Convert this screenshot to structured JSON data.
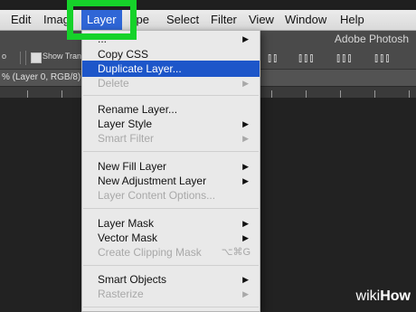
{
  "menubar": {
    "items": [
      {
        "label": "Edit"
      },
      {
        "label": "Imag"
      },
      {
        "label": "Layer"
      },
      {
        "label": "ype"
      },
      {
        "label": "Select"
      },
      {
        "label": "Filter"
      },
      {
        "label": "View"
      },
      {
        "label": "Window"
      },
      {
        "label": "Help"
      }
    ]
  },
  "options_bar": {
    "doc_app": "Adobe Photosh",
    "show_transform": "Show Transf",
    "left_fragment": "o"
  },
  "tab": {
    "label": "% (Layer 0, RGB/8) *"
  },
  "layer_menu": {
    "items": [
      {
        "label": "...",
        "submenu": true
      },
      {
        "label": "Copy CSS"
      },
      {
        "label": "Duplicate Layer...",
        "highlight": true
      },
      {
        "label": "Delete",
        "disabled": true,
        "submenu": true
      },
      {
        "label": "Rename Layer..."
      },
      {
        "label": "Layer Style",
        "submenu": true
      },
      {
        "label": "Smart Filter",
        "disabled": true,
        "submenu": true
      },
      {
        "label": "New Fill Layer",
        "submenu": true
      },
      {
        "label": "New Adjustment Layer",
        "submenu": true
      },
      {
        "label": "Layer Content Options...",
        "disabled": true
      },
      {
        "label": "Layer Mask",
        "submenu": true
      },
      {
        "label": "Vector Mask",
        "submenu": true
      },
      {
        "label": "Create Clipping Mask",
        "disabled": true,
        "shortcut": "⌥⌘G"
      },
      {
        "label": "Smart Objects",
        "submenu": true
      },
      {
        "label": "Rasterize",
        "disabled": true,
        "submenu": true
      }
    ]
  },
  "watermark": {
    "brand_a": "wiki",
    "brand_b": "How"
  },
  "colors": {
    "highlight": "#1d56c9",
    "annotation": "#16d22a",
    "menubar_active": "#2f66d6"
  },
  "icons": {
    "submenu": "triangle-right",
    "align": "align-icon"
  }
}
